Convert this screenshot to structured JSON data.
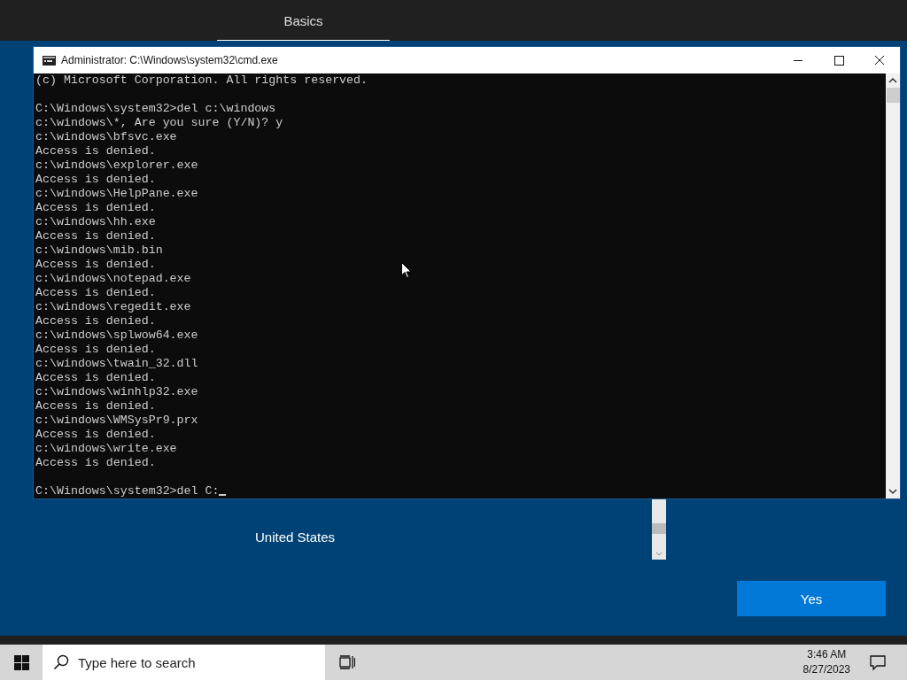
{
  "setup": {
    "tabs": [
      {
        "label": "Basics",
        "selected": true
      }
    ],
    "list": {
      "items": [
        "United States"
      ]
    },
    "buttons": [
      "Yes"
    ]
  },
  "console_window": {
    "title": "Administrator: C:\\Windows\\system32\\cmd.exe",
    "blocks": [
      [
        "(c) Microsoft Corporation. All rights reserved."
      ],
      [
        "C:\\Windows\\system32>del c:\\windows",
        "c:\\windows\\*, Are you sure (Y/N)? y",
        "c:\\windows\\bfsvc.exe",
        "Access is denied.",
        "c:\\windows\\explorer.exe",
        "Access is denied.",
        "c:\\windows\\HelpPane.exe",
        "Access is denied.",
        "c:\\windows\\hh.exe",
        "Access is denied.",
        "c:\\windows\\mib.bin",
        "Access is denied.",
        "c:\\windows\\notepad.exe",
        "Access is denied.",
        "c:\\windows\\regedit.exe",
        "Access is denied.",
        "c:\\windows\\splwow64.exe",
        "Access is denied.",
        "c:\\windows\\twain_32.dll",
        "Access is denied.",
        "c:\\windows\\winhlp32.exe",
        "Access is denied.",
        "c:\\windows\\WMSysPr9.prx",
        "Access is denied.",
        "c:\\windows\\write.exe",
        "Access is denied."
      ],
      [
        "C:\\Windows\\system32>del C:"
      ]
    ]
  },
  "taskbar": {
    "search": {
      "placeholder": "Type here to search"
    },
    "time": "3:46 AM",
    "date": "8/27/2023"
  }
}
